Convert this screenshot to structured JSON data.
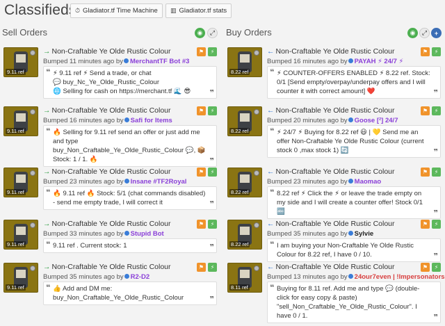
{
  "header": {
    "brand": "Classifieds",
    "btn_time_machine": "Gladiator.tf Time Machine",
    "btn_stats": "Gladiator.tf stats"
  },
  "sell": {
    "title": "Sell Orders",
    "listings": [
      {
        "price": "9.11 ref",
        "item": "Non-Craftable Ye Olde Rustic Colour",
        "bumped": "Bumped 11 minutes ago by",
        "user": "MerchantTF Bot #3",
        "user_color": "#8a3fd8",
        "text": "⚡ 9.11 ref ⚡ Send a trade, or chat\n💬 buy_Nc_Ye_Olde_Rustic_Colour\n🌐 Selling for cash on https://merchant.tf 🌊 😎"
      },
      {
        "price": "9.11 ref",
        "item": "Non-Craftable Ye Olde Rustic Colour",
        "bumped": "Bumped 16 minutes ago by",
        "user": "Safi for Items",
        "user_color": "#8a3fd8",
        "text": "🔥 Selling for 9.11 ref send an offer or just add me and type buy_Non_Craftable_Ye_Olde_Rustic_Colour 💬, 📦 Stock: 1 / 1. 🔥"
      },
      {
        "price": "9.11 ref",
        "item": "Non-Craftable Ye Olde Rustic Colour",
        "bumped": "Bumped 23 minutes ago by",
        "user": "Insane #TF2Royal",
        "user_color": "#8a3fd8",
        "text": "🔥 9.11 ref 🔥 Stock: 5/1 (chat commands disabled) - send me empty trade, I will correct it"
      },
      {
        "price": "9.11 ref",
        "item": "Non-Craftable Ye Olde Rustic Colour",
        "bumped": "Bumped 33 minutes ago by",
        "user": "Stupid Bot",
        "user_color": "#8a3fd8",
        "text": "9.11 ref . Current stock: 1"
      },
      {
        "price": "9.11 ref",
        "item": "Non-Craftable Ye Olde Rustic Colour",
        "bumped": "Bumped 35 minutes ago by",
        "user": "R2-D2",
        "user_color": "#8a3fd8",
        "text": "👍 Add and DM me:\nbuy_Non_Craftable_Ye_Olde_Rustic_Colour"
      }
    ]
  },
  "buy": {
    "title": "Buy Orders",
    "listings": [
      {
        "price": "8.22 ref",
        "item": "Non-Craftable Ye Olde Rustic Colour",
        "bumped": "Bumped 16 minutes ago by",
        "user": "PAYAH ⚡ 24/7 ⚡",
        "user_color": "#8a3fd8",
        "text": "⚡ COUNTER-OFFERS ENABLED ⚡ 8.22 ref. Stock: 0/1 [Send empty/overpay/underpay offers and I will counter it with correct amount] ❤️"
      },
      {
        "price": "8.22 ref",
        "item": "Non-Craftable Ye Olde Rustic Colour",
        "bumped": "Bumped 20 minutes ago by",
        "user": "Goose [²] 24/7",
        "user_color": "#8a3fd8",
        "text": "⚡ 24/7 ⚡ Buying for 8.22 ref 😃 | 💛 Send me an offer Non-Craftable Ye Olde Rustic Colour (current stock 0 ,max stock 1) 🔄"
      },
      {
        "price": "8.22 ref",
        "item": "Non-Craftable Ye Olde Rustic Colour",
        "bumped": "Bumped 23 minutes ago by",
        "user": "Maomao",
        "user_color": "#8a3fd8",
        "text": "8.22 ref ⚡ Click the ⚡ or leave the trade empty on my side and I will create a counter offer! Stock 0/1 🔤"
      },
      {
        "price": "8.22 ref",
        "item": "Non-Craftable Ye Olde Rustic Colour",
        "bumped": "Bumped 35 minutes ago by",
        "user": "Sylvie",
        "user_color": "#222222",
        "text": "I am buying your Non-Craftable Ye Olde Rustic Colour for 8.22 ref, I have 0 / 10."
      },
      {
        "price": "8.11 ref",
        "item": "Non-Craftable Ye Olde Rustic Colour",
        "bumped": "Bumped 13 minutes ago by",
        "user": "24our7even | !Impersonators!",
        "user_color": "#d83f3f",
        "text": "Buying for 8.11 ref. Add me and type 💬 (double-click for easy copy & paste) \"sell_Non_Craftable_Ye_Olde_Rustic_Colour\". I have 0 / 1."
      }
    ]
  }
}
